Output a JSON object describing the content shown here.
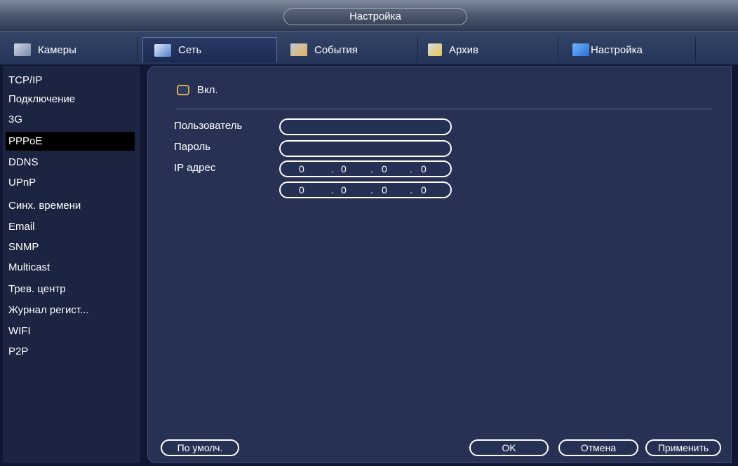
{
  "window": {
    "title": "Настройка"
  },
  "tabs": [
    {
      "label": "Камеры",
      "icon": "cameras-icon"
    },
    {
      "label": "Сеть",
      "icon": "network-icon"
    },
    {
      "label": "События",
      "icon": "events-icon"
    },
    {
      "label": "Архив",
      "icon": "archive-icon"
    },
    {
      "label": "Настройка",
      "icon": "settings-icon"
    }
  ],
  "sidebar": {
    "items": [
      {
        "label": "TCP/IP"
      },
      {
        "label": "Подключение"
      },
      {
        "label": "3G"
      },
      {
        "label": "PPPoE"
      },
      {
        "label": "DDNS"
      },
      {
        "label": "UPnP"
      },
      {
        "label": "Синх. времени"
      },
      {
        "label": "Email"
      },
      {
        "label": "SNMP"
      },
      {
        "label": "Multicast"
      },
      {
        "label": "Трев. центр"
      },
      {
        "label": "Журнал регист..."
      },
      {
        "label": "WIFI"
      },
      {
        "label": "P2P"
      }
    ],
    "selected": "PPPoE"
  },
  "form": {
    "enable_label": "Вкл.",
    "enabled": false,
    "user_label": "Пользователь",
    "user_value": "",
    "password_label": "Пароль",
    "password_value": "",
    "ip_label": "IP адрес",
    "ip1": [
      "0",
      "0",
      "0",
      "0"
    ],
    "ip2": [
      "0",
      "0",
      "0",
      "0"
    ]
  },
  "buttons": {
    "default": "По умолч.",
    "ok": "OK",
    "cancel": "Отмена",
    "apply": "Применить"
  },
  "colors": {
    "accent": "#d8a84a",
    "selected_bg": "#000000"
  }
}
